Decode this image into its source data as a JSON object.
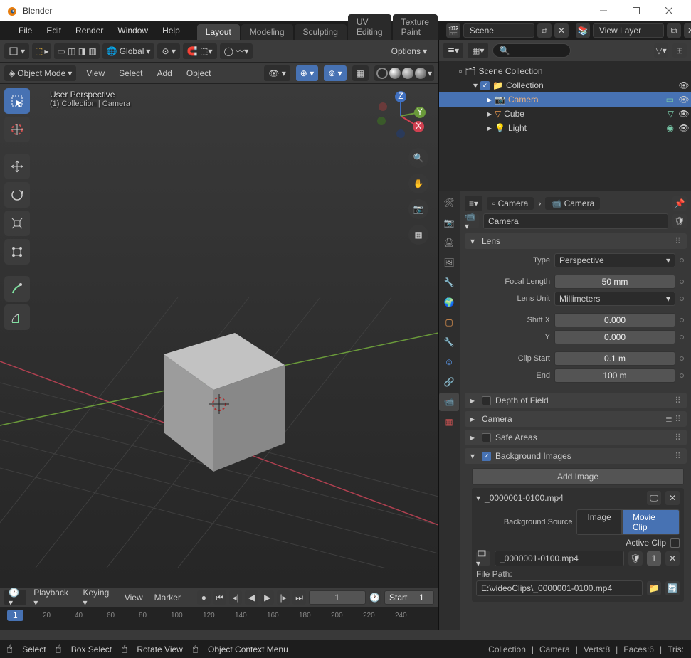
{
  "window": {
    "title": "Blender"
  },
  "menu": {
    "items": [
      "File",
      "Edit",
      "Render",
      "Window",
      "Help"
    ]
  },
  "workspace_tabs": [
    "Layout",
    "Modeling",
    "Sculpting",
    "UV Editing",
    "Texture Paint"
  ],
  "active_workspace": "Layout",
  "scene": {
    "label": "Scene",
    "view_layer": "View Layer"
  },
  "viewport": {
    "mode": "Object Mode",
    "orientation": "Global",
    "header_menus": [
      "View",
      "Select",
      "Add",
      "Object"
    ],
    "options_label": "Options",
    "overlay_line1": "User Perspective",
    "overlay_line2": "(1) Collection | Camera"
  },
  "timeline": {
    "menus": [
      "Playback",
      "Keying",
      "View",
      "Marker"
    ],
    "current_frame": "1",
    "start_label": "Start",
    "start_val": "1",
    "ticks": [
      "20",
      "40",
      "60",
      "80",
      "100",
      "120",
      "140",
      "160",
      "180",
      "200",
      "220",
      "240"
    ]
  },
  "outliner": {
    "root": "Scene Collection",
    "collection": "Collection",
    "items": [
      {
        "name": "Camera",
        "selected": true,
        "icon": "camera"
      },
      {
        "name": "Cube",
        "selected": false,
        "icon": "mesh"
      },
      {
        "name": "Light",
        "selected": false,
        "icon": "light"
      }
    ]
  },
  "props": {
    "breadcrumb": [
      "Camera",
      "Camera"
    ],
    "name": "Camera",
    "lens": {
      "label": "Lens",
      "type_label": "Type",
      "type": "Perspective",
      "focal_label": "Focal Length",
      "focal": "50 mm",
      "unit_label": "Lens Unit",
      "unit": "Millimeters",
      "shiftx_label": "Shift X",
      "shiftx": "0.000",
      "shifty_label": "Y",
      "shifty": "0.000",
      "clipstart_label": "Clip Start",
      "clipstart": "0.1 m",
      "clipend_label": "End",
      "clipend": "100 m"
    },
    "panels": {
      "dof": "Depth of Field",
      "camera": "Camera",
      "safe": "Safe Areas",
      "bgimg": "Background Images"
    },
    "bg": {
      "add_label": "Add Image",
      "item_name": "_0000001-0100.mp4",
      "source_label": "Background Source",
      "source_image": "Image",
      "source_clip": "Movie Clip",
      "active_clip_label": "Active Clip",
      "clip_name": "_0000001-0100.mp4",
      "filepath_label": "File Path:",
      "filepath": "E:\\videoClips\\_0000001-0100.mp4"
    }
  },
  "status": {
    "select": "Select",
    "box": "Box Select",
    "rotate": "Rotate View",
    "ctx": "Object Context Menu",
    "info": [
      "Collection",
      "Camera",
      "Verts:8",
      "Faces:6",
      "Tris:"
    ]
  }
}
